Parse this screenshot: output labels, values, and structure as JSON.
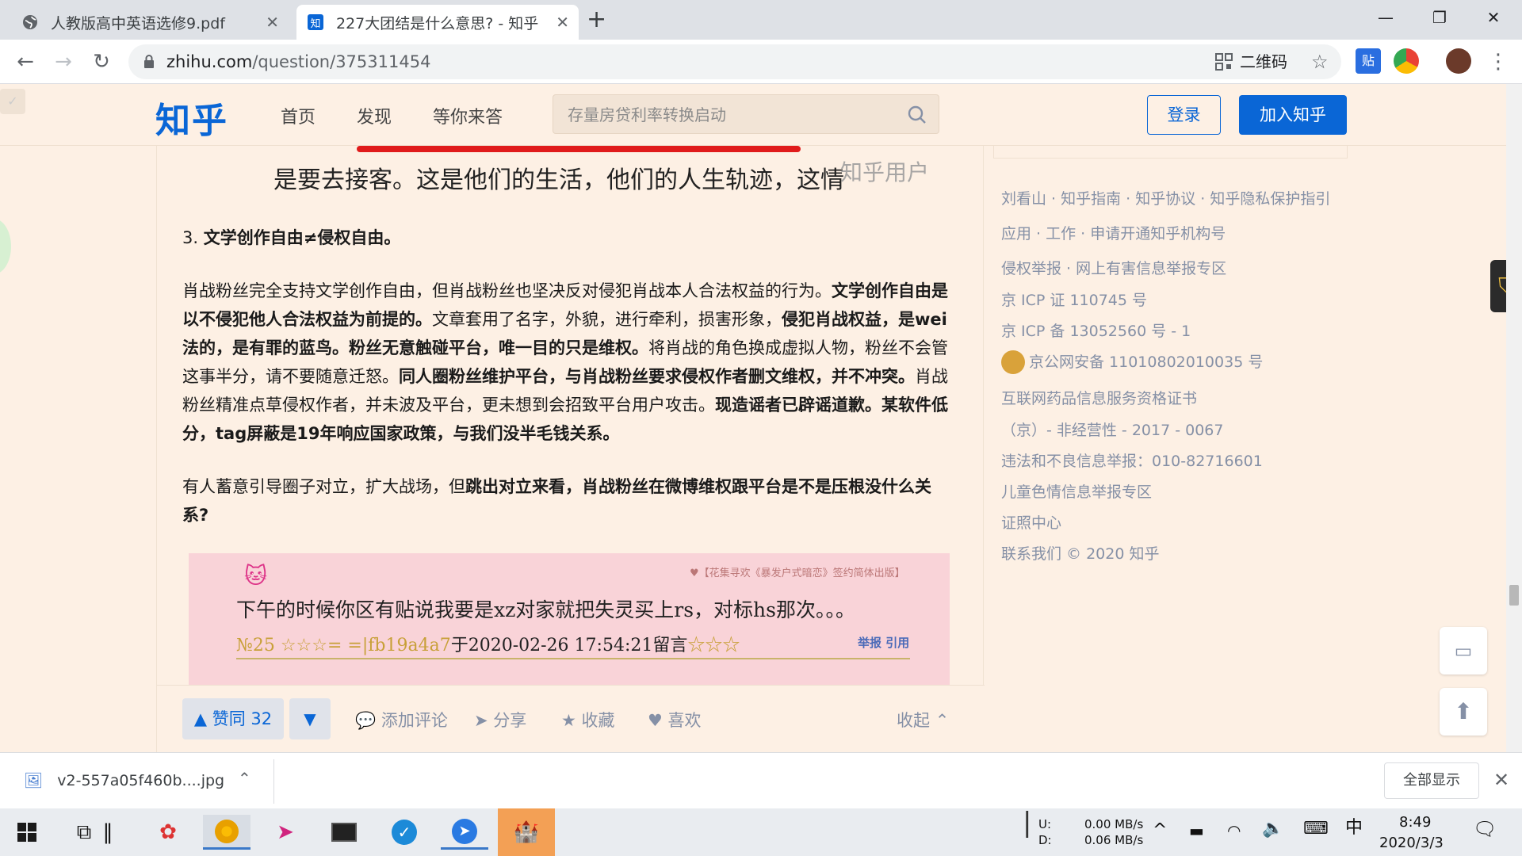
{
  "browser": {
    "tabs": [
      {
        "title": "人教版高中英语选修9.pdf",
        "active": false,
        "icon": "globe-icon"
      },
      {
        "title": "227大团结是什么意思? - 知乎",
        "active": true,
        "icon": "zhihu-favicon-icon"
      }
    ],
    "new_tab_symbol": "+",
    "window_controls": [
      "—",
      "❐",
      "✕"
    ],
    "url_host": "zhihu.com",
    "url_path": "/question/375311454",
    "qr_label": "二维码",
    "extension_label": "贴"
  },
  "zhihu": {
    "logo": "知乎",
    "nav": [
      "首页",
      "发现",
      "等你来答"
    ],
    "search_placeholder": "存量房贷利率转换启动",
    "login": "登录",
    "join": "加入知乎"
  },
  "answer": {
    "img1_text": "是要去接客。这是他们的生活，他们的人生轨迹，这情",
    "img1_watermark": "知乎用户",
    "heading_num": "3.",
    "heading_text": "文学创作自由≠侵权自由。",
    "para1": [
      {
        "t": "肖战粉丝完全支持文学创作自由，但肖战粉丝也坚决反对侵犯肖战本人合法权益的行为。",
        "b": false
      },
      {
        "t": "文学创作自由是以不侵犯他人合法权益为前提的。",
        "b": true
      },
      {
        "t": "文章套用了名字，外貌，进行牵利，损害形象，",
        "b": false
      },
      {
        "t": "侵犯肖战权益，是wei法的，是有罪的蓝鸟。粉丝无意触碰平台，唯一目的只是维权。",
        "b": true
      },
      {
        "t": "将肖战的角色换成虚拟人物，粉丝不会管这事半分，请不要随意迁怒。",
        "b": false
      },
      {
        "t": "同人圈粉丝维护平台，与肖战粉丝要求侵权作者删文维权，并不冲突。",
        "b": true
      },
      {
        "t": "肖战粉丝精准点草侵权作者，并未波及平台，更未想到会招致平台用户攻击。",
        "b": false
      },
      {
        "t": "现造谣者已辟谣道歉。某软件低分，tag屏蔽是19年响应国家政策，与我们没半毛钱关系。",
        "b": true
      }
    ],
    "para2": [
      {
        "t": "有人蓄意引导圈子对立，扩大战场，但",
        "b": false
      },
      {
        "t": "跳出对立来看，肖战粉丝在微博维权跟平台是不是压根没什么关系?",
        "b": true
      }
    ],
    "img2_tag": "♥【花集寻欢《暴发户式暗恋》签约简体出版】",
    "img2_line1": "下午的时候你区有贴说我要是xz对家就把失灵买上rs，对标hs那次。。。",
    "img2_no": "№25",
    "img2_stars": "☆☆☆",
    "img2_eq": "= =|fb19a4a7",
    "img2_time": "于2020-02-26 17:54:21留言",
    "img2_report": "举报 引用"
  },
  "actions": {
    "upvote": "赞同 32",
    "comment": "添加评论",
    "share": "分享",
    "collect": "收藏",
    "like": "喜欢",
    "collapse": "收起"
  },
  "sidebar": {
    "lines": [
      "刘看山 · 知乎指南 · 知乎协议 · 知乎隐私保护指引",
      "应用 · 工作 · 申请开通知乎机构号",
      "侵权举报 · 网上有害信息举报专区",
      "京 ICP 证 110745 号",
      "京 ICP 备 13052560 号 - 1",
      "京公网安备 11010802010035 号",
      "互联网药品信息服务资格证书",
      "（京）- 非经营性 - 2017 - 0067",
      "违法和不良信息举报：010-82716601",
      "儿童色情信息举报专区",
      "证照中心",
      "联系我们 © 2020 知乎"
    ]
  },
  "download": {
    "filename": "v2-557a05f460b....jpg",
    "show_all": "全部显示"
  },
  "taskbar": {
    "net_u_label": "U:",
    "net_d_label": "D:",
    "net_u": "0.00 MB/s",
    "net_d": "0.06 MB/s",
    "ime": "中",
    "time": "8:49",
    "date": "2020/3/3"
  },
  "colors": {
    "zhihu_blue": "#0a66d6",
    "page_bg": "#fdf0e4"
  }
}
